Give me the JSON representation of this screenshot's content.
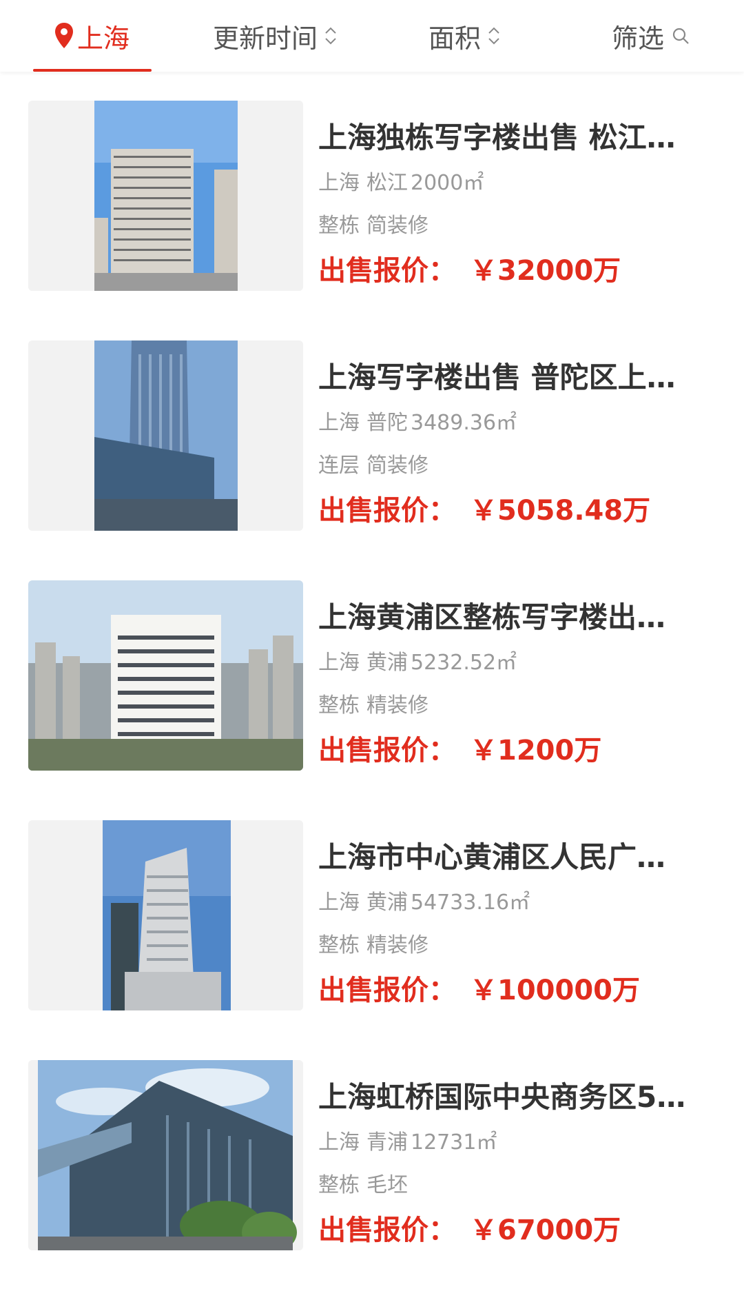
{
  "header": {
    "city": "上海",
    "tabs": {
      "update_time": "更新时间",
      "area": "面积",
      "filter": "筛选"
    },
    "active_color": "#e12d1e",
    "icons": {
      "city": "location-pin-icon",
      "sort": "sort-updown-icon",
      "filter": "search-icon"
    }
  },
  "listings": [
    {
      "title": "上海独栋写字楼出售 松江…",
      "city": "上海",
      "district": "松江",
      "area": "2000㎡",
      "floor_type": "整栋",
      "decoration": "简装修",
      "price_label": "出售报价：",
      "price": "￥32000万"
    },
    {
      "title": "上海写字楼出售 普陀区上…",
      "city": "上海",
      "district": "普陀",
      "area": "3489.36㎡",
      "floor_type": "连层",
      "decoration": "简装修",
      "price_label": "出售报价：",
      "price": "￥5058.48万"
    },
    {
      "title": "上海黄浦区整栋写字楼出…",
      "city": "上海",
      "district": "黄浦",
      "area": "5232.52㎡",
      "floor_type": "整栋",
      "decoration": "精装修",
      "price_label": "出售报价：",
      "price": "￥1200万"
    },
    {
      "title": "上海市中心黄浦区人民广…",
      "city": "上海",
      "district": "黄浦",
      "area": "54733.16㎡",
      "floor_type": "整栋",
      "decoration": "精装修",
      "price_label": "出售报价：",
      "price": "￥100000万"
    },
    {
      "title": "上海虹桥国际中央商务区5…",
      "city": "上海",
      "district": "青浦",
      "area": "12731㎡",
      "floor_type": "整栋",
      "decoration": "毛坯",
      "price_label": "出售报价：",
      "price": "￥67000万"
    }
  ]
}
